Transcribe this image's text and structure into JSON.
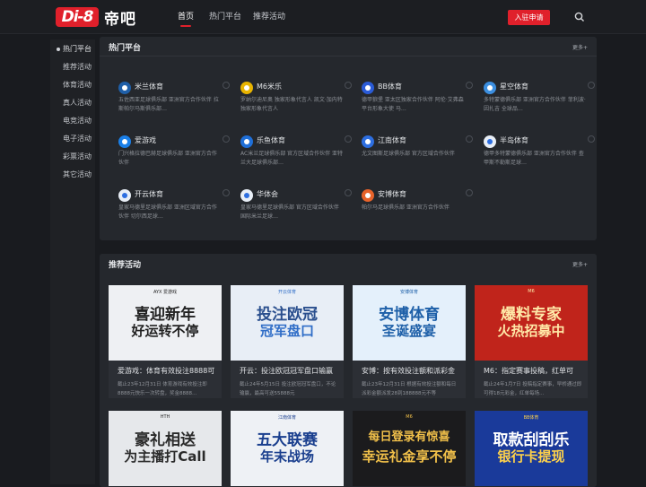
{
  "header": {
    "logo_mark": "Di-8",
    "logo_text": "帝吧",
    "nav": [
      "首页",
      "热门平台",
      "推荐活动"
    ],
    "join_label": "入驻申请"
  },
  "sidebar": {
    "items": [
      "热门平台",
      "推荐活动",
      "体育活动",
      "真人活动",
      "电竞活动",
      "电子活动",
      "彩票活动",
      "其它活动"
    ]
  },
  "hot": {
    "title": "热门平台",
    "more": "更多+",
    "platforms": [
      {
        "name": "米兰体育",
        "logo": "milan-logo",
        "color": "#1f5fa8",
        "desc": "五佐西亚足球俱乐部 亚洲官方合作伙伴 拉斯帕尔马斯俱乐部…"
      },
      {
        "name": "M6米乐",
        "logo": "m6-logo",
        "color": "#e8b400",
        "desc": "罗纳尔迪尼奥 独家形象代言人 凯文·加内特 独家形象代言人"
      },
      {
        "name": "BB体育",
        "logo": "bb-logo",
        "color": "#2a5bd7",
        "desc": "德甲狼堡 亚太区独家合作伙伴 阿伦·艾弗森 平台形象大使 马…"
      },
      {
        "name": "星空体育",
        "logo": "xingkong-logo",
        "color": "#3c8fe0",
        "desc": "多特蒙德俱乐部 亚洲官方合作伙伴 菲利波·因扎吉 全球品…"
      },
      {
        "name": "爱游戏",
        "logo": "ayx-logo",
        "color": "#1a7fe8",
        "desc": "门兴格拉德巴赫足球俱乐部 亚洲官方合作伙伴"
      },
      {
        "name": "乐鱼体育",
        "logo": "leyu-logo",
        "color": "#1f6fd8",
        "desc": "AC米兰足球俱乐部 官方区域合作伙伴 亚特兰大足球俱乐部…"
      },
      {
        "name": "江南体育",
        "logo": "jiangnan-logo",
        "color": "#2d6ee0",
        "desc": "尤文图斯足球俱乐部 官方区域合作伙伴"
      },
      {
        "name": "半岛体育",
        "logo": "bandao-logo",
        "color": "#e8eef6",
        "desc": "德甲多特蒙德俱乐部 亚洲官方合作伙伴 查甲斯不勒斯足球…"
      },
      {
        "name": "开云体育",
        "logo": "kaiyun-logo",
        "color": "#e8eef6",
        "desc": "皇家马德里足球俱乐部 亚洲区域官方合作伙伴 切尔西足球…"
      },
      {
        "name": "华体会",
        "logo": "huatihui-logo",
        "color": "#e8eef6",
        "desc": "皇家马德里足球俱乐部 官方区域合作伙伴 国际米兰足球…"
      },
      {
        "name": "安博体育",
        "logo": "anbo-logo",
        "color": "#e8632a",
        "desc": "帕尔马足球俱乐部 亚洲官方合作伙伴"
      }
    ]
  },
  "promo": {
    "title": "推荐活动",
    "more": "更多+",
    "cards": [
      {
        "title": "爱游戏：体育有效投注8888可",
        "desc": "截止23年12月31日 体育游戏有效投注即8888元快乐一次转盘，奖金8888…",
        "banner_main": "喜迎新年",
        "banner_sub": "好运转不停",
        "bg": "#eef0f3",
        "fg": "#222",
        "accent": "#222",
        "banner_brand": "AYX 爱游戏"
      },
      {
        "title": "开云：投注欧冠冠军盘口输赢",
        "desc": "截止24年5月15日 投注欧冠冠军盘口，不论输赢，最高可送55888元",
        "banner_main": "投注欧冠",
        "banner_sub": "冠军盘口",
        "bg": "#e8eef6",
        "fg": "#2a4f8e",
        "accent": "#2f6dc7",
        "banner_brand": "开云体育"
      },
      {
        "title": "安博：按有效投注额和派彩金",
        "desc": "截止23年12月31日 根据有效投注额和每日派彩金额派发28到188888元不等",
        "banner_main": "安博体育",
        "banner_sub": "圣诞盛宴",
        "bg": "#e4f0fb",
        "fg": "#1d5fa8",
        "accent": "#1d5fa8",
        "banner_brand": "安博体育"
      },
      {
        "title": "M6：指定赛事投稿，红单可",
        "desc": "截止24年1月7日 投稿指定赛事，早桥通过即可得18元彩金，红单每场…",
        "banner_main": "爆料专家",
        "banner_sub": "火热招募中",
        "bg": "#c0241b",
        "fg": "#ffe9a8",
        "accent": "#ffe9a8",
        "banner_brand": "M6"
      },
      {
        "title": "",
        "desc": "",
        "banner_main": "豪礼相送",
        "banner_sub": "为主播打Call",
        "bg": "#e6e8eb",
        "fg": "#2a2a2a",
        "accent": "#2a2a2a",
        "banner_brand": "HTH"
      },
      {
        "title": "",
        "desc": "",
        "banner_main": "五大联赛",
        "banner_sub": "年末战场",
        "bg": "#eef1f5",
        "fg": "#1a3f8e",
        "accent": "#1a3f8e",
        "banner_brand": "江南体育"
      },
      {
        "title": "",
        "desc": "",
        "banner_main": "每日登录有惊喜",
        "banner_sub": "幸运礼金享不停",
        "bg": "#1b1b1d",
        "fg": "#f2c14a",
        "accent": "#f2c14a",
        "banner_brand": "M6"
      },
      {
        "title": "",
        "desc": "",
        "banner_main": "取款刮刮乐",
        "banner_sub": "银行卡提现",
        "bg": "#1a3a9a",
        "fg": "#ffffff",
        "accent": "#ffd24a",
        "banner_brand": "BB体育"
      }
    ]
  },
  "colors": {
    "brand": "#e0202b",
    "bg": "#191b1f",
    "panel": "#25282d"
  }
}
